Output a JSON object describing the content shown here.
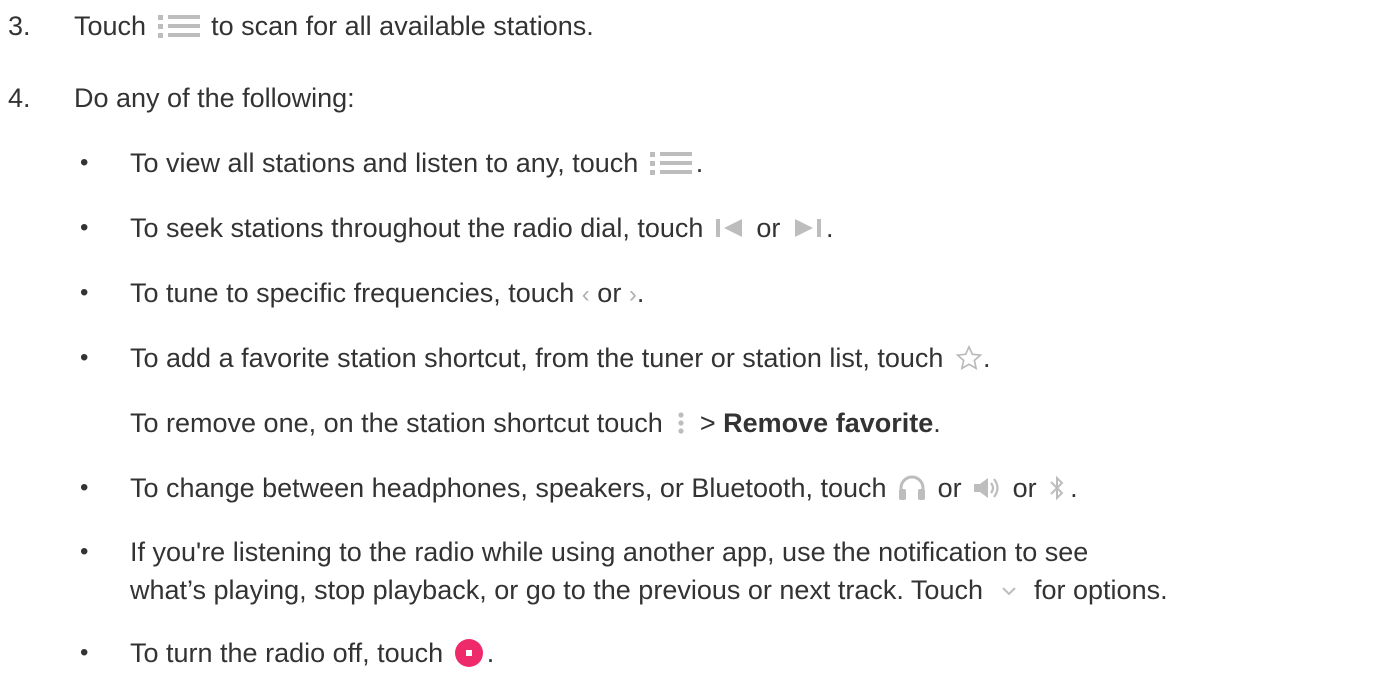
{
  "steps": [
    {
      "number": "3.",
      "pre": "Touch",
      "icon": "list-icon",
      "post": "to scan for all available stations."
    },
    {
      "number": "4.",
      "text": "Do any of the following:"
    }
  ],
  "bullets": {
    "marker": "•",
    "view_all": {
      "pre": "To view all stations and listen to any, touch",
      "icon": "list-icon",
      "post": "."
    },
    "seek": {
      "pre": "To seek stations throughout the radio dial, touch",
      "icon1": "skip-previous-icon",
      "mid": "or",
      "icon2": "skip-next-icon",
      "post": "."
    },
    "tune": {
      "pre": "To tune to specific frequencies, touch",
      "icon1_glyph": "‹",
      "icon1": "chevron-left-icon",
      "mid": "or",
      "icon2_glyph": "›",
      "icon2": "chevron-right-icon",
      "post": "."
    },
    "favorite": {
      "pre": "To add a favorite station shortcut, from the tuner or station list, touch",
      "icon": "star-outline-icon",
      "post": "."
    },
    "remove_favorite": {
      "pre": "To remove one, on the station shortcut touch",
      "icon": "more-vert-icon",
      "mid": ">",
      "bold": "Remove favorite",
      "post": "."
    },
    "output": {
      "pre": "To change between headphones, speakers, or Bluetooth, touch",
      "icon1": "headphones-icon",
      "mid1": "or",
      "icon2": "speaker-icon",
      "mid2": "or",
      "icon3": "bluetooth-icon",
      "post": "."
    },
    "notification": {
      "line1": "If you're listening to the radio while using another app, use the notification to see",
      "line2_pre": "what’s playing, stop playback, or go to the previous or next track. Touch",
      "icon": "chevron-down-icon",
      "line2_post": "for options."
    },
    "turn_off": {
      "pre": "To turn the radio off, touch",
      "icon": "stop-icon",
      "post": "."
    }
  },
  "colors": {
    "text": "#333333",
    "icon_gray": "#bdbdbd",
    "stop_pink": "#ee2a6b"
  }
}
